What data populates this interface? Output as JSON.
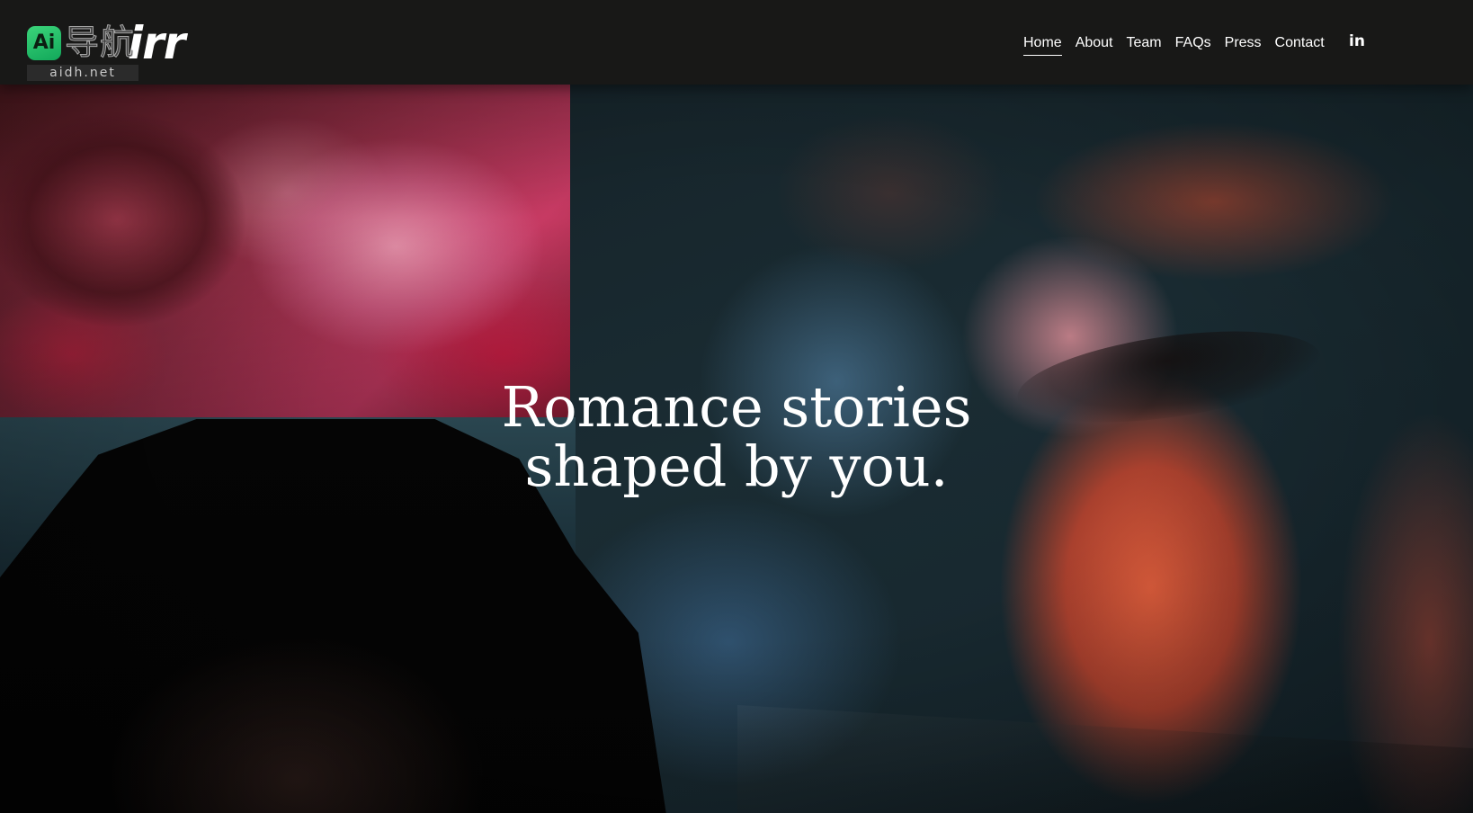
{
  "header": {
    "brand": {
      "wordmark_visible": "irr",
      "watermark_badge": "Ai",
      "watermark_text": "导航",
      "watermark_url": "aidh.net"
    },
    "nav": {
      "items": [
        {
          "label": "Home",
          "active": true
        },
        {
          "label": "About",
          "active": false
        },
        {
          "label": "Team",
          "active": false
        },
        {
          "label": "FAQs",
          "active": false
        },
        {
          "label": "Press",
          "active": false
        },
        {
          "label": "Contact",
          "active": false
        }
      ]
    },
    "social": {
      "label": "in",
      "icon": "linkedin-icon"
    }
  },
  "hero": {
    "headline_line1": "Romance stories",
    "headline_line2": "shaped by you."
  },
  "colors": {
    "header_bg": "#181817",
    "text": "#ffffff",
    "watermark_green": "#2bbf6a",
    "flower_pink": "#c73a63",
    "face_orange": "#e05f3c",
    "teal": "#2a4650"
  }
}
